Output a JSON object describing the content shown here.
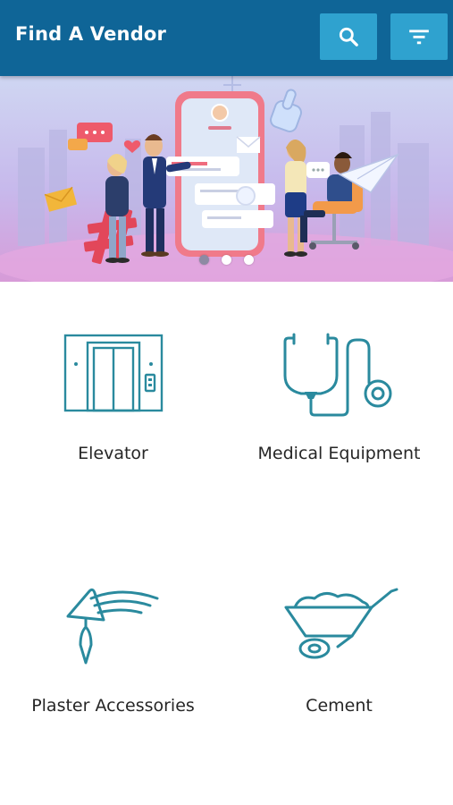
{
  "header": {
    "title": "Find A Vendor",
    "search_icon": "search-icon",
    "filter_icon": "filter-icon"
  },
  "banner": {
    "illustration": "people-chatting-around-smartphone-illustration",
    "slides_count": 3,
    "active_slide": 1
  },
  "categories": [
    {
      "label": "Elevator",
      "icon": "elevator-icon"
    },
    {
      "label": "Medical Equipment",
      "icon": "stethoscope-icon"
    },
    {
      "label": "Plaster Accessories",
      "icon": "trowel-icon"
    },
    {
      "label": "Cement",
      "icon": "wheelbarrow-icon"
    }
  ],
  "colors": {
    "appbar": "#0f6597",
    "appbar_button": "#2fa2cf",
    "icon_teal": "#2a8a9e",
    "text": "#262626"
  }
}
